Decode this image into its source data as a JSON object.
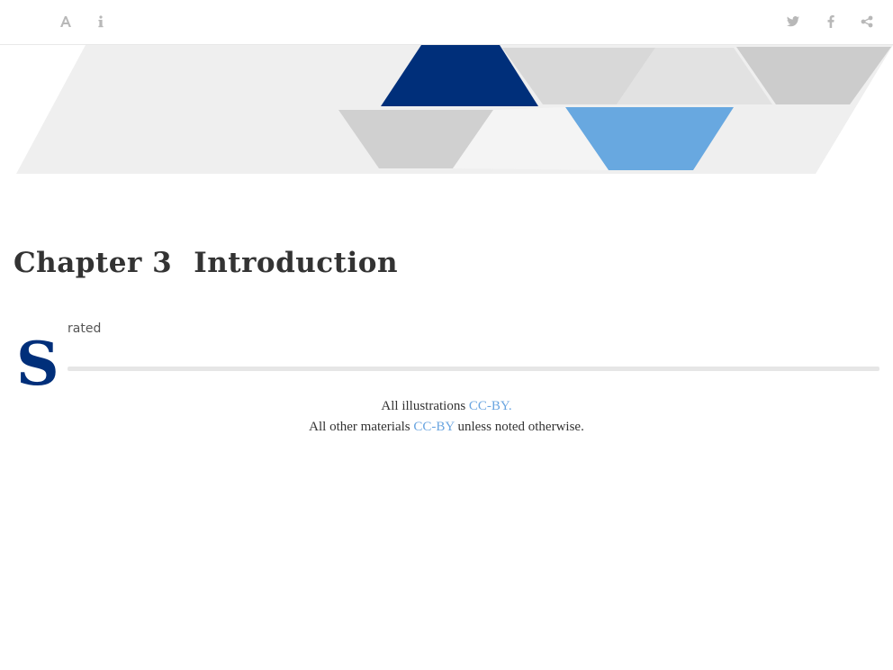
{
  "toolbar": {
    "left_icons": [
      "font-icon",
      "info-icon"
    ],
    "right_icons": [
      "twitter-icon",
      "facebook-icon",
      "share-icon"
    ]
  },
  "colors": {
    "dark_blue": "#002f7a",
    "light_blue": "#68a8e0",
    "gray": "#cccccc",
    "pale": "#efefef",
    "link": "#6aa5e0"
  },
  "chapter": {
    "number": "Chapter 3",
    "title": "Introduction"
  },
  "intro": {
    "drop_cap": "S",
    "status": "rated",
    "progress": 0
  },
  "license": {
    "line1_prefix": "All illustrations ",
    "line1_link": "CC-BY.",
    "line2_prefix": "All other materials ",
    "line2_link": "CC-BY",
    "line2_suffix": " unless noted otherwise."
  }
}
